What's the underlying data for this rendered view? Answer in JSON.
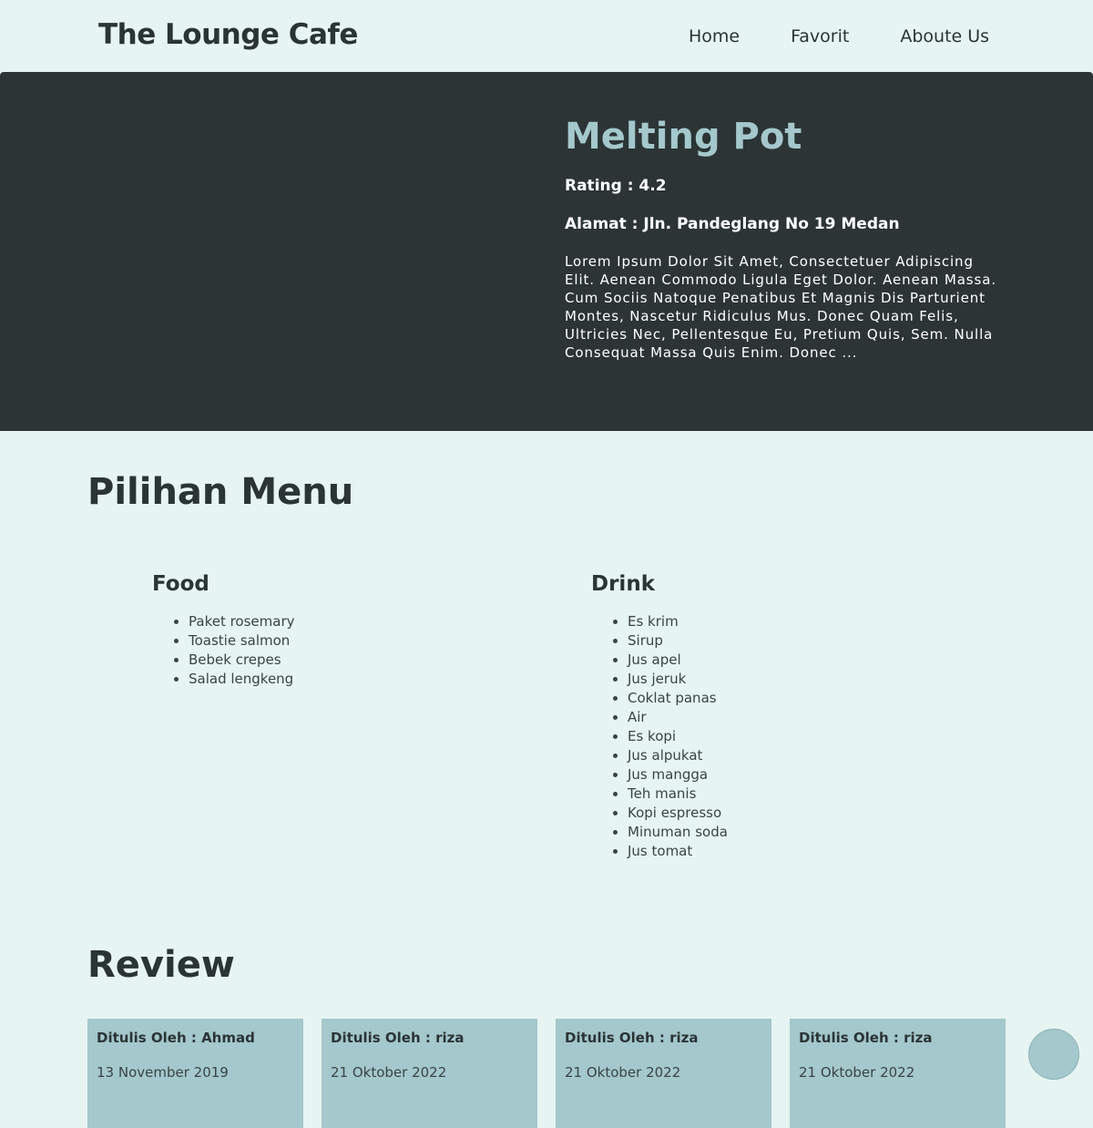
{
  "navbar": {
    "brand": "The Lounge Cafe",
    "links": [
      "Home",
      "Favorit",
      "Aboute Us"
    ]
  },
  "hero": {
    "title": "Melting Pot",
    "rating": "Rating : 4.2",
    "address": "Alamat : Jln. Pandeglang No 19 Medan",
    "description": "Lorem Ipsum Dolor Sit Amet, Consectetuer Adipiscing Elit. Aenean Commodo Ligula Eget Dolor. Aenean Massa. Cum Sociis Natoque Penatibus Et Magnis Dis Parturient Montes, Nascetur Ridiculus Mus. Donec Quam Felis, Ultricies Nec, Pellentesque Eu, Pretium Quis, Sem. Nulla Consequat Massa Quis Enim. Donec ..."
  },
  "menu": {
    "title": "Pilihan Menu",
    "food": {
      "heading": "Food",
      "items": [
        "Paket rosemary",
        "Toastie salmon",
        "Bebek crepes",
        "Salad lengkeng"
      ]
    },
    "drink": {
      "heading": "Drink",
      "items": [
        "Es krim",
        "Sirup",
        "Jus apel",
        "Jus jeruk",
        "Coklat panas",
        "Air",
        "Es kopi",
        "Jus alpukat",
        "Jus mangga",
        "Teh manis",
        "Kopi espresso",
        "Minuman soda",
        "Jus tomat"
      ]
    }
  },
  "review": {
    "title": "Review",
    "cards": [
      {
        "author": "Ditulis Oleh : Ahmad",
        "date": "13 November 2019"
      },
      {
        "author": "Ditulis Oleh : riza",
        "date": "21 Oktober 2022"
      },
      {
        "author": "Ditulis Oleh : riza",
        "date": "21 Oktober 2022"
      },
      {
        "author": "Ditulis Oleh : riza",
        "date": "21 Oktober 2022"
      }
    ]
  },
  "fab": {
    "icon": "missing-glyph-icon",
    "glyph": ""
  },
  "colors": {
    "background": "#e6f4f2",
    "hero": "#2c3435",
    "accent": "#a4c8cb",
    "text": "#2b3435"
  }
}
